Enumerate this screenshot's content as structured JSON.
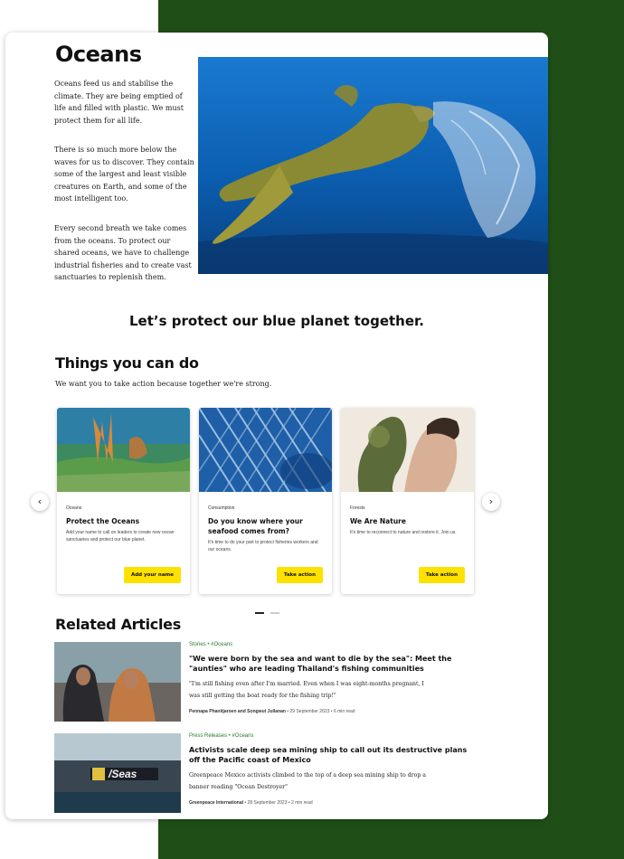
{
  "page": {
    "title": "Oceans",
    "paragraphs": [
      "Oceans feed us and stabilise the climate. They are being emptied of life and filled with plastic. We must protect them for all life.",
      "There is so much more below the waves for us to discover. They contain some of the largest and least visible creatures on Earth, and some of the most intelligent too.",
      "Every second breath we take comes from the oceans. To protect our shared oceans, we have to challenge industrial fisheries and to create vast sanctuaries to replenish them."
    ],
    "tagline": "Let’s protect our blue planet together."
  },
  "actions": {
    "heading": "Things you can do",
    "intro": "We want you to take action because together we're strong.",
    "cards": [
      {
        "category": "Oceans",
        "title": "Protect the Oceans",
        "description": "Add your name to call on leaders to create new ocean sanctuaries and protect our blue planet.",
        "button": "Add your name"
      },
      {
        "category": "Consumption",
        "title": "Do you know where your seafood comes from?",
        "description": "It's time to do your part to protect fisheries workers and our oceans.",
        "button": "Take action"
      },
      {
        "category": "Forests",
        "title": "We Are Nature",
        "description": "It's time to reconnect to nature and restore it. Join us.",
        "button": "Take action"
      }
    ],
    "prev_icon": "‹",
    "next_icon": "›"
  },
  "related": {
    "heading": "Related Articles",
    "articles": [
      {
        "tags": "Stories  •  #Oceans",
        "title": "\"We were born by the sea and want to die by the sea\": Meet the \"aunties\" who are leading Thailand's fishing communities",
        "excerpt": "\"I'm still fishing even after I'm married. Even when I was eight-months pregnant, I was still getting the boat ready for the fishing trip!\"",
        "author": "Pennapa Phanitjaroen and Songwut Jullanan",
        "date": " • 29 September 2023 • 6 min read"
      },
      {
        "tags": "Press Releases  •  #Oceans",
        "title": "Activists scale deep sea mining ship to call out its destructive plans off the Pacific coast of Mexico",
        "excerpt": "Greenpeace Mexico activists climbed to the top of a deep sea mining ship to drop a banner reading \"Ocean Destroyer\"",
        "author": "Greenpeace International",
        "date": " • 28 September 2023 • 2 min read"
      }
    ]
  },
  "colors": {
    "page_bg": "#1f4f16",
    "button": "#ffe100",
    "tag": "#2a7a2a"
  }
}
